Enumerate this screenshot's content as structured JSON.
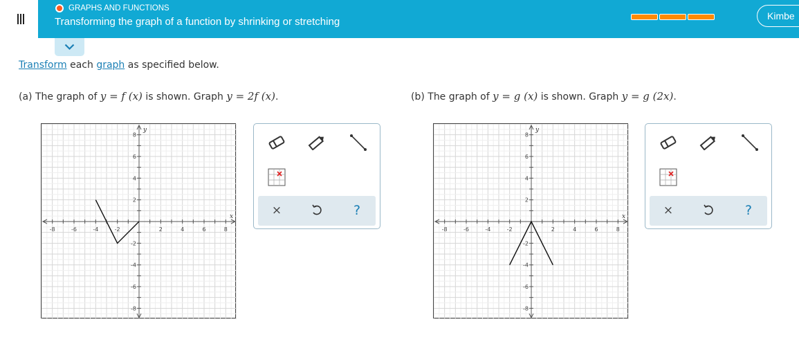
{
  "header": {
    "topic": "GRAPHS AND FUNCTIONS",
    "title": "Transforming the graph of a function by shrinking or stretching",
    "user_label": "Kimbe",
    "progress_segments": 3,
    "colors": {
      "bar": "#11a9d4",
      "progress": "#ff8a00",
      "topic_dot": "#ff5a1f"
    }
  },
  "instructions": {
    "word1": "Transform",
    "word2": "each",
    "word3": "graph",
    "word4": "as specified below."
  },
  "part_a": {
    "prefix": "(a)  The graph of",
    "func": "y = f (x)",
    "middle": "is shown. Graph",
    "target": "y = 2f (x)",
    "end": "."
  },
  "part_b": {
    "prefix": "(b)  The graph of",
    "func": "y = g (x)",
    "middle": "is shown. Graph",
    "target": "y = g (2x)",
    "end": "."
  },
  "chart_data": [
    {
      "type": "line",
      "xlabel": "x",
      "ylabel": "y",
      "xlim": [
        -9,
        9
      ],
      "ylim": [
        -9,
        9
      ],
      "x_tick_labels": [
        "-8",
        "-6",
        "-4",
        "-2",
        "2",
        "4",
        "6",
        "8"
      ],
      "y_tick_labels": [
        "8",
        "6",
        "4",
        "2",
        "-2",
        "-4",
        "-6",
        "-8"
      ],
      "grid": true,
      "series": [
        {
          "x": [
            -4,
            -2,
            0
          ],
          "y": [
            2,
            -2,
            0
          ]
        }
      ]
    },
    {
      "type": "line",
      "xlabel": "x",
      "ylabel": "y",
      "xlim": [
        -9,
        9
      ],
      "ylim": [
        -9,
        9
      ],
      "x_tick_labels": [
        "-8",
        "-6",
        "-4",
        "-2",
        "2",
        "4",
        "6",
        "8"
      ],
      "y_tick_labels": [
        "8",
        "6",
        "4",
        "2",
        "-2",
        "-4",
        "-6",
        "-8"
      ],
      "grid": true,
      "series": [
        {
          "x": [
            -2,
            0,
            2
          ],
          "y": [
            -4,
            0,
            -4
          ]
        }
      ]
    }
  ],
  "toolbar": {
    "tools": [
      "eraser-icon",
      "pencil-icon",
      "line-segment-icon",
      "point-grid-icon"
    ],
    "actions": {
      "clear": "×",
      "undo": "undo-icon",
      "help": "?"
    }
  }
}
